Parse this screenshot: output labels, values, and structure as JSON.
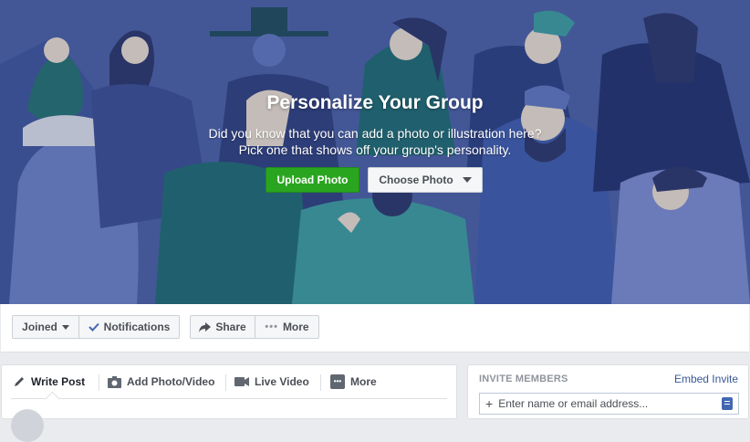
{
  "cover": {
    "title": "Personalize Your Group",
    "line1": "Did you know that you can add a photo or illustration here?",
    "line2": "Pick one that shows off your group's personality.",
    "upload_label": "Upload Photo",
    "choose_label": "Choose Photo"
  },
  "actions": {
    "joined": "Joined",
    "notifications": "Notifications",
    "share": "Share",
    "more": "More"
  },
  "composer": {
    "tabs": [
      "Write Post",
      "Add Photo/Video",
      "Live Video",
      "More"
    ]
  },
  "invite": {
    "title": "INVITE MEMBERS",
    "embed": "Embed Invite",
    "placeholder": "Enter name or email address..."
  },
  "colors": {
    "upload_green": "#2aa520",
    "link_blue": "#385898",
    "cover_blue": "#5b6fa8"
  },
  "icons": [
    "pencil-icon",
    "camera-icon",
    "video-camera-icon",
    "ellipsis-icon",
    "share-arrow-icon",
    "checkmark-icon",
    "plus-icon",
    "contacts-icon"
  ]
}
